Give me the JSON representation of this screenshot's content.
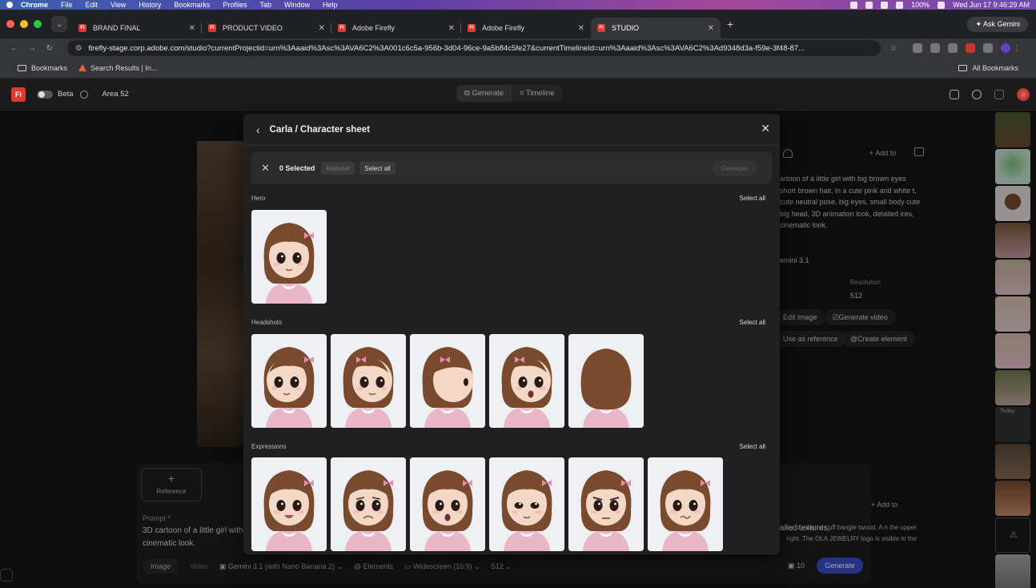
{
  "menubar": {
    "app": "Chrome",
    "items": [
      "File",
      "Edit",
      "View",
      "History",
      "Bookmarks",
      "Profiles",
      "Tab",
      "Window",
      "Help"
    ],
    "battery": "100%",
    "clock": "Wed Jun 17  9:46:29 AM"
  },
  "tabs": [
    {
      "label": "BRAND FINAL",
      "favicon": "Fi"
    },
    {
      "label": "PRODUCT VIDEO",
      "favicon": "Fi"
    },
    {
      "label": "Adobe Firefly",
      "favicon": "Fi"
    },
    {
      "label": "Adobe Firefly",
      "favicon": "Fi"
    },
    {
      "label": "STUDIO",
      "favicon": "Fi",
      "active": true
    }
  ],
  "ask_gemini": "Ask Gemini",
  "address": {
    "url": "firefly-stage.corp.adobe.com/studio?currentProjectid=urn%3Aaaid%3Asc%3AVA6C2%3A001c6c5a-956b-3d04-96ce-9a5b84c5fe27&currentTimelineId=urn%3Aaaid%3Asc%3AVA6C2%3Ad9348d3a-f59e-3f48-87..."
  },
  "bookmarks": {
    "items": [
      "Bookmarks",
      "Search Results | In..."
    ],
    "all": "All Bookmarks"
  },
  "app_header": {
    "logo": "Fi",
    "beta": "Beta",
    "project": "Area 52",
    "modes": [
      "Generate",
      "Timeline"
    ]
  },
  "right_panel": {
    "description": "artoon of a little girl with big brown eyes short brown hair, in a cute pink and white t, cute neutral pose, big eyes, small body cute big head, 3D animation look, detailed ires, cinematic look.",
    "model": "emini 3.1",
    "resolution_label": "Resolution",
    "resolution_value": "512",
    "add_to": "Add to",
    "edit_image": "Edit image",
    "generate_video": "Generate video",
    "use_as_reference": "Use as reference",
    "create_element": "Create element",
    "today": "Today"
  },
  "prompt": {
    "reference_label": "Reference",
    "label": "Prompt *",
    "text": "3D cartoon of a little girl with cinematic look.",
    "text_right": "ailed textures,",
    "side_text": "e flat lay of ndant d cuff bangle twood. A n the upper right. The OLA JEWELRY logo is visible in the",
    "tabs": [
      "Image",
      "Video"
    ],
    "model": "Gemini 3.1 (with Nano Banana 2)",
    "elements": "Elements",
    "aspect": "Widescreen (16:9)",
    "size": "512",
    "count": "10",
    "generate": "Generate",
    "add_to": "Add to"
  },
  "modal": {
    "title": "Carla / Character sheet",
    "selected": "0 Selected",
    "remove": "Remove",
    "select_all": "Select all",
    "generate": "Generate",
    "sections": [
      {
        "label": "Hero",
        "select_all": "Select all",
        "count": 1
      },
      {
        "label": "Headshots",
        "select_all": "Select all",
        "count": 5
      },
      {
        "label": "Expressions",
        "select_all": "Select all",
        "count": 6
      }
    ]
  },
  "colors": {
    "accent": "#3b4ec9",
    "firefly_red": "#e03a2f",
    "modal_bg": "#202020",
    "hair": "#7a4a2f",
    "skin": "#f3d8c8",
    "shirt": "#e9b7c6",
    "bow": "#e98cb0"
  }
}
